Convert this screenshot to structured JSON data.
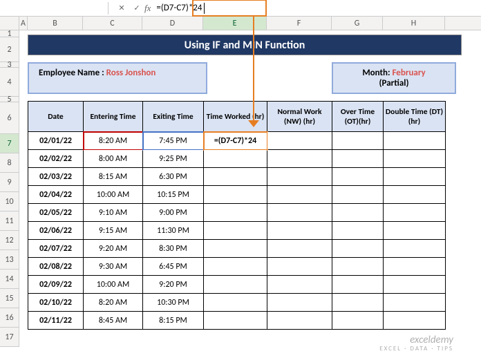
{
  "formulaBar": {
    "formula": "=(D7-C7)*24"
  },
  "columns": [
    "A",
    "B",
    "C",
    "D",
    "E",
    "F",
    "G",
    "H"
  ],
  "banner": "Using IF and MIN Function",
  "employee": {
    "label": "Employee Name : ",
    "value": "Ross Jonshon"
  },
  "month": {
    "label": "Month: ",
    "value": "February",
    "sub": "(Partial)"
  },
  "headers": {
    "date": "Date",
    "enter": "Entering Time",
    "exit": "Exiting Time",
    "worked": "Time Worked (hr)",
    "normal": "Normal Work (NW) (hr)",
    "ot": "Over Time (OT)(hr)",
    "dt": "Double Time (DT) (hr)"
  },
  "editCell": "=(D7-C7)*24",
  "rows": [
    {
      "date": "02/01/22",
      "enter": "8:20 AM",
      "exit": "7:45 PM"
    },
    {
      "date": "02/02/22",
      "enter": "8:00 AM",
      "exit": "9:25 PM"
    },
    {
      "date": "02/03/22",
      "enter": "8:15 AM",
      "exit": "6:30 PM"
    },
    {
      "date": "02/04/22",
      "enter": "10:00 AM",
      "exit": "10:15 PM"
    },
    {
      "date": "02/05/22",
      "enter": "9:10 AM",
      "exit": "9:00 PM"
    },
    {
      "date": "02/06/22",
      "enter": "9:15 AM",
      "exit": "11:30 PM"
    },
    {
      "date": "02/07/22",
      "enter": "9:20 AM",
      "exit": "8:30 PM"
    },
    {
      "date": "02/08/22",
      "enter": "9:30 AM",
      "exit": "6:45 PM"
    },
    {
      "date": "02/09/22",
      "enter": "10:00 AM",
      "exit": "9:20 PM"
    },
    {
      "date": "02/10/22",
      "enter": "8:20 AM",
      "exit": "10:30 PM"
    },
    {
      "date": "02/11/22",
      "enter": "8:45 AM",
      "exit": "8:15 PM"
    }
  ],
  "watermark": {
    "main": "exceldemy",
    "sub": "EXCEL · DATA · TIPS"
  }
}
